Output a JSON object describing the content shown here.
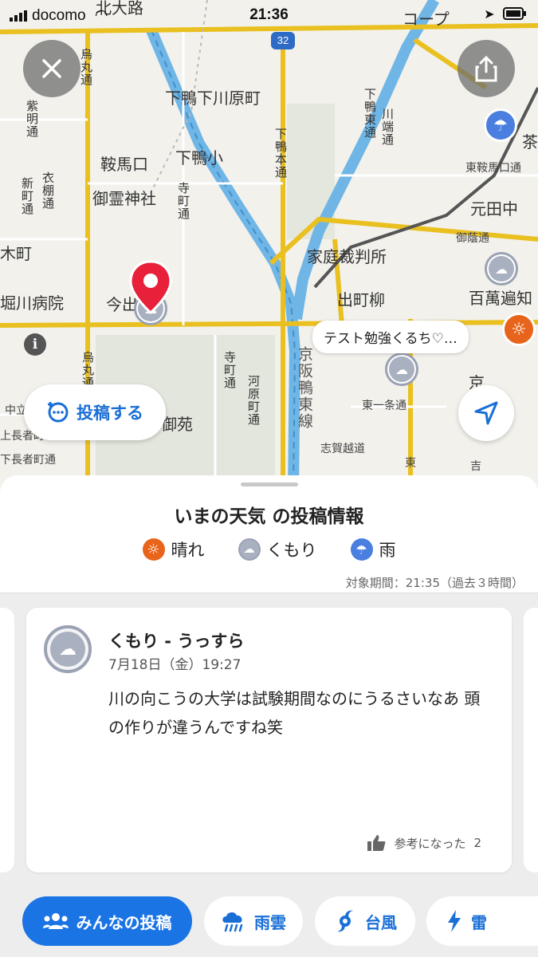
{
  "status_bar": {
    "carrier": "docomo",
    "time": "21:36"
  },
  "map": {
    "labels": {
      "kitaoji": "北大路",
      "coop": "コープ",
      "route": "32",
      "karasuma": "烏丸通",
      "shimogamo_shimokawara": "下鴨下川原町",
      "shimogamo_hondori": "下鴨本通",
      "shimogamo_higashi": "下鴨東通",
      "kawabata": "川端通",
      "shimei": "紫明通",
      "kurama_guchi": "鞍馬口",
      "shimogamo_sho": "下鴨小",
      "koromodana": "衣棚通",
      "shinmachi": "新町通",
      "goryo": "御霊神社",
      "teramachi": "寺町通",
      "higashi_kurama": "東鞍馬口通",
      "motota": "元田中",
      "cha": "茶",
      "mikage": "御蔭通",
      "katei": "家庭裁判所",
      "kimachi": "木町",
      "hyakuman": "百萬遍知",
      "horikawa": "堀川病院",
      "imade": "今出",
      "demachi": "出町柳",
      "keihan": "京阪鴨東線",
      "karasuma2": "烏丸通",
      "teramachi2": "寺町通",
      "kawaramachi": "河原町通",
      "gyoen": "御苑",
      "higashi_ichijo": "東一条通",
      "shiga": "志賀越道",
      "kyo": "京",
      "nakadachi": "中立",
      "kamichoja": "上長者町",
      "shimochoja": "下長者町通",
      "higashi": "東",
      "yoshi": "吉"
    },
    "bubble_text": "テスト勉強くるち♡…",
    "post_button": "投稿する"
  },
  "sheet": {
    "title": "いまの天気 の投稿情報",
    "legend": [
      {
        "label": "晴れ",
        "icon": "sun-icon",
        "color": "#e8641b"
      },
      {
        "label": "くもり",
        "icon": "cloud-icon",
        "color": "#9aa2b3"
      },
      {
        "label": "雨",
        "icon": "umbrella-icon",
        "color": "#4a7fe0"
      }
    ],
    "period": "対象期間：21:35（過去３時間）",
    "post": {
      "title": "くもり - うっすら",
      "date": "7月18日（金）19:27",
      "body": "川の向こうの大学は試験期間なのにうるさいなあ 頭の作りが違うんですね笑",
      "helpful_label": "参考になった",
      "helpful_count": "2"
    },
    "tabs": [
      {
        "label": "みんなの投稿",
        "icon": "people-icon",
        "active": true
      },
      {
        "label": "雨雲",
        "icon": "rain-cloud-icon",
        "active": false
      },
      {
        "label": "台風",
        "icon": "typhoon-icon",
        "active": false
      },
      {
        "label": "雷",
        "icon": "lightning-icon",
        "active": false
      }
    ]
  },
  "colors": {
    "accent": "#1a74e4",
    "road": "#e9c020",
    "river": "#6fb6e6",
    "pin": "#e8203a"
  }
}
